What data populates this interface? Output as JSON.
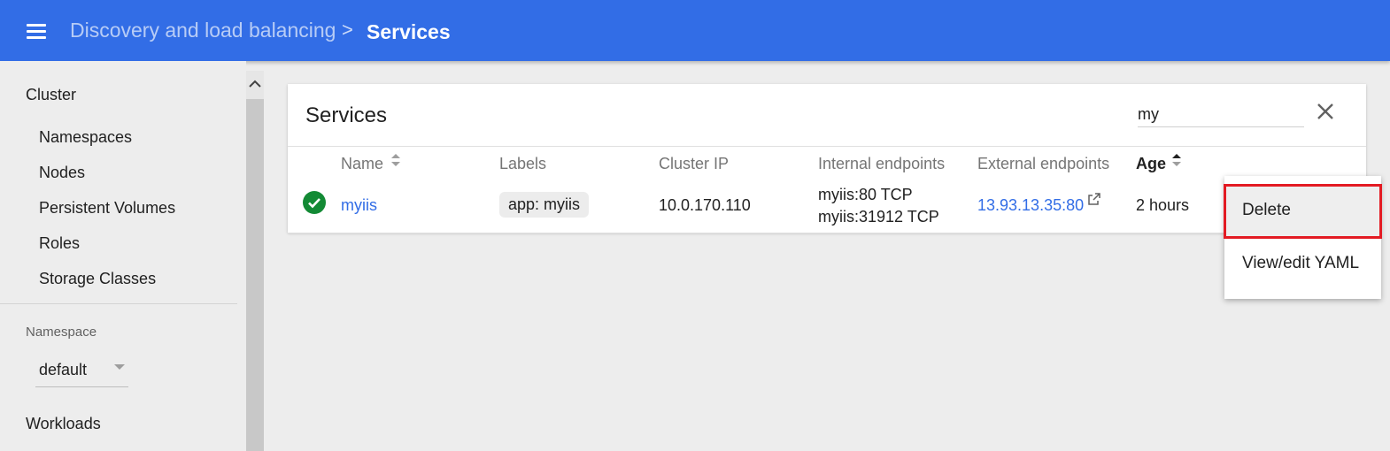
{
  "header": {
    "breadcrumb_parent": "Discovery and load balancing",
    "breadcrumb_separator": ">",
    "breadcrumb_current": "Services",
    "bg_color": "#326de6"
  },
  "sidebar": {
    "cluster_label": "Cluster",
    "items": [
      "Namespaces",
      "Nodes",
      "Persistent Volumes",
      "Roles",
      "Storage Classes"
    ],
    "namespace_label": "Namespace",
    "namespace_value": "default",
    "workloads_label": "Workloads"
  },
  "services": {
    "title": "Services",
    "search_value": "my",
    "columns": [
      "Name",
      "Labels",
      "Cluster IP",
      "Internal endpoints",
      "External endpoints",
      "Age"
    ],
    "sorted_column": "Age",
    "rows": [
      {
        "status": "ok",
        "name": "myiis",
        "label": "app: myiis",
        "cluster_ip": "10.0.170.110",
        "internal_endpoints": [
          "myiis:80 TCP",
          "myiis:31912 TCP"
        ],
        "external_endpoint": "13.93.13.35:80",
        "age": "2 hours"
      }
    ]
  },
  "context_menu": {
    "items": [
      "Delete",
      "View/edit YAML"
    ],
    "highlighted": "Delete",
    "highlight_color": "#e31b23"
  },
  "colors": {
    "accent": "#326de6",
    "success": "#138a35",
    "background": "#ededed"
  }
}
